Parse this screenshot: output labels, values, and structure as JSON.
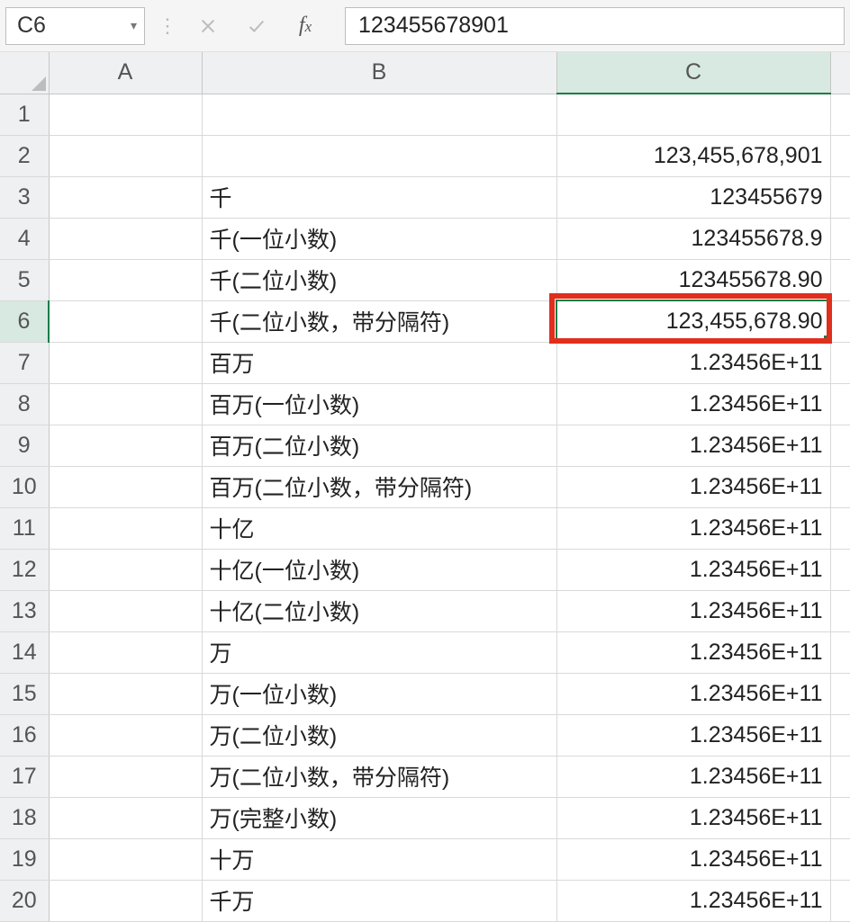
{
  "formula_bar": {
    "cell_ref": "C6",
    "formula_value": "123455678901"
  },
  "columns": [
    "A",
    "B",
    "C"
  ],
  "active_column_index": 2,
  "active_row_index": 5,
  "selected_cell": "C6",
  "rows": [
    {
      "n": "1",
      "a": "",
      "b": "",
      "c": ""
    },
    {
      "n": "2",
      "a": "",
      "b": "",
      "c": "123,455,678,901"
    },
    {
      "n": "3",
      "a": "",
      "b": "千",
      "c": "123455679"
    },
    {
      "n": "4",
      "a": "",
      "b": "千(一位小数)",
      "c": "123455678.9"
    },
    {
      "n": "5",
      "a": "",
      "b": "千(二位小数)",
      "c": "123455678.90"
    },
    {
      "n": "6",
      "a": "",
      "b": "千(二位小数，带分隔符)",
      "c": "123,455,678.90"
    },
    {
      "n": "7",
      "a": "",
      "b": "百万",
      "c": "1.23456E+11"
    },
    {
      "n": "8",
      "a": "",
      "b": "百万(一位小数)",
      "c": "1.23456E+11"
    },
    {
      "n": "9",
      "a": "",
      "b": "百万(二位小数)",
      "c": "1.23456E+11"
    },
    {
      "n": "10",
      "a": "",
      "b": "百万(二位小数，带分隔符)",
      "c": "1.23456E+11"
    },
    {
      "n": "11",
      "a": "",
      "b": "十亿",
      "c": "1.23456E+11"
    },
    {
      "n": "12",
      "a": "",
      "b": "十亿(一位小数)",
      "c": "1.23456E+11"
    },
    {
      "n": "13",
      "a": "",
      "b": "十亿(二位小数)",
      "c": "1.23456E+11"
    },
    {
      "n": "14",
      "a": "",
      "b": "万",
      "c": "1.23456E+11"
    },
    {
      "n": "15",
      "a": "",
      "b": "万(一位小数)",
      "c": "1.23456E+11"
    },
    {
      "n": "16",
      "a": "",
      "b": "万(二位小数)",
      "c": "1.23456E+11"
    },
    {
      "n": "17",
      "a": "",
      "b": "万(二位小数，带分隔符)",
      "c": "1.23456E+11"
    },
    {
      "n": "18",
      "a": "",
      "b": "万(完整小数)",
      "c": "1.23456E+11"
    },
    {
      "n": "19",
      "a": "",
      "b": "十万",
      "c": "1.23456E+11"
    },
    {
      "n": "20",
      "a": "",
      "b": "千万",
      "c": "1.23456E+11"
    }
  ],
  "highlight": {
    "row_index": 5,
    "color": "#e02f1d"
  }
}
